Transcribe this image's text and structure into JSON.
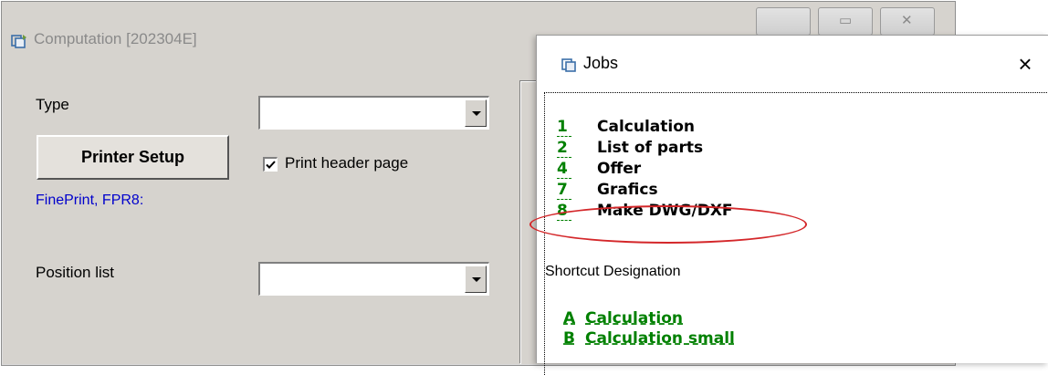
{
  "main_window": {
    "title": "Computation [202304E]",
    "type_label": "Type",
    "type_value": "",
    "printer_setup_label": "Printer Setup",
    "print_header_label": "Print header page",
    "print_header_checked": true,
    "printer_name": "FinePrint, FPR8:",
    "position_list_label": "Position list",
    "position_list_value": ""
  },
  "jobs_window": {
    "title": "Jobs",
    "close_glyph": "×",
    "jobs": [
      {
        "key": "1",
        "label": "Calculation"
      },
      {
        "key": "2",
        "label": "List of parts"
      },
      {
        "key": "4",
        "label": "Offer"
      },
      {
        "key": "7",
        "label": "Grafics"
      },
      {
        "key": "8",
        "label": "Make DWG/DXF",
        "highlighted": true
      }
    ],
    "shortcut_header": "Shortcut  Designation",
    "shortcuts": [
      {
        "key": "A",
        "label": "Calculation"
      },
      {
        "key": "B",
        "label": "Calculation small"
      }
    ]
  },
  "colors": {
    "window_bg": "#d6d3ce",
    "link_green": "#008000",
    "printer_blue": "#0000cc",
    "highlight_red": "#d4272a"
  }
}
